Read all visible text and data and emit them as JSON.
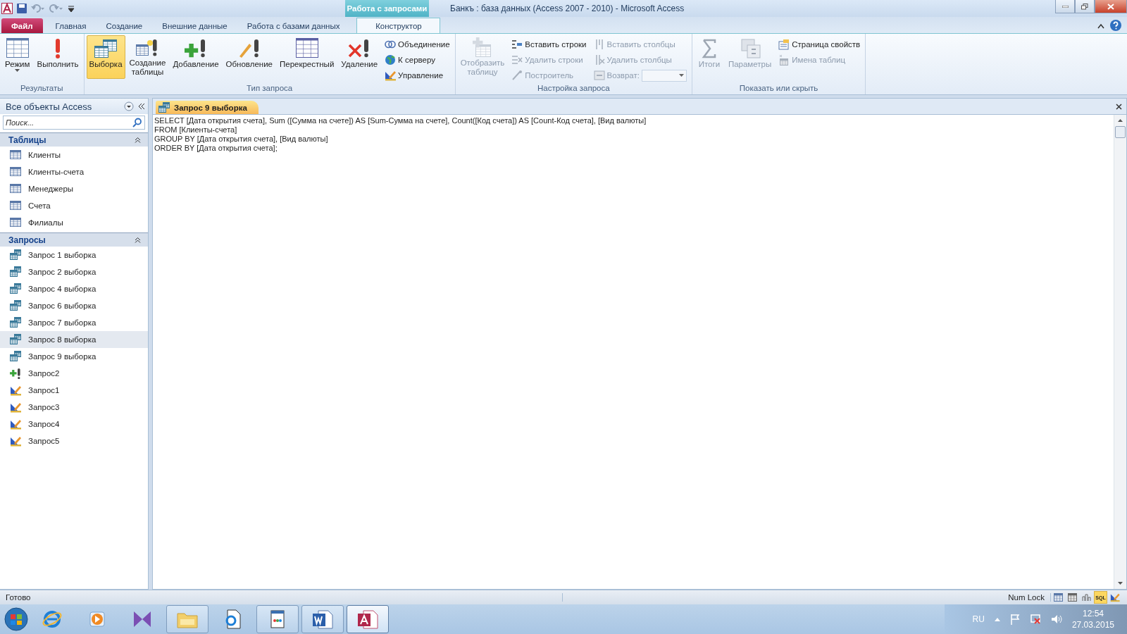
{
  "title_bar": {
    "title": "Банкъ : база данных (Access 2007 - 2010)  -  Microsoft Access",
    "context_tab": "Работа с запросами"
  },
  "ribbon_tabs": [
    {
      "label": "Файл",
      "kind": "file",
      "selected": false
    },
    {
      "label": "Главная",
      "kind": "tab",
      "selected": false
    },
    {
      "label": "Создание",
      "kind": "tab",
      "selected": false
    },
    {
      "label": "Внешние данные",
      "kind": "tab",
      "selected": false
    },
    {
      "label": "Работа с базами данных",
      "kind": "tab",
      "selected": false
    },
    {
      "label": "Конструктор",
      "kind": "context",
      "selected": true
    }
  ],
  "ribbon_groups": [
    {
      "label": "Результаты",
      "buttons": [
        {
          "kind": "large",
          "label": "Режим",
          "dropdown": true,
          "disabled": false
        },
        {
          "kind": "large",
          "label": "Выполнить",
          "disabled": false
        }
      ]
    },
    {
      "label": "Тип запроса",
      "buttons": [
        {
          "kind": "large",
          "label": "Выборка",
          "selected": true,
          "disabled": false
        },
        {
          "kind": "large",
          "label": "Создание таблицы",
          "selected": false,
          "disabled": false
        },
        {
          "kind": "large",
          "label": "Добавление",
          "selected": false,
          "disabled": false
        },
        {
          "kind": "large",
          "label": "Обновление",
          "selected": false,
          "disabled": false
        },
        {
          "kind": "large",
          "label": "Перекрестный",
          "selected": false,
          "disabled": false
        },
        {
          "kind": "large",
          "label": "Удаление",
          "selected": false,
          "disabled": false
        },
        {
          "kind": "small",
          "label": "Объединение",
          "disabled": false
        },
        {
          "kind": "small",
          "label": "К серверу",
          "disabled": false
        },
        {
          "kind": "small",
          "label": "Управление",
          "disabled": false
        }
      ]
    },
    {
      "label": "Настройка запроса",
      "buttons": [
        {
          "kind": "large",
          "label": "Отобразить таблицу",
          "disabled": true
        },
        {
          "kind": "small",
          "label": "Вставить строки",
          "disabled": false
        },
        {
          "kind": "small",
          "label": "Удалить строки",
          "disabled": true
        },
        {
          "kind": "small",
          "label": "Построитель",
          "disabled": true
        },
        {
          "kind": "small",
          "label": "Вставить столбцы",
          "disabled": true
        },
        {
          "kind": "small",
          "label": "Удалить столбцы",
          "disabled": true
        },
        {
          "kind": "combo",
          "label": "Возврат:",
          "disabled": true
        }
      ]
    },
    {
      "label": "Показать или скрыть",
      "buttons": [
        {
          "kind": "large",
          "label": "Итоги",
          "disabled": true
        },
        {
          "kind": "large",
          "label": "Параметры",
          "disabled": true
        },
        {
          "kind": "small",
          "label": "Страница свойств",
          "disabled": false
        },
        {
          "kind": "small",
          "label": "Имена таблиц",
          "disabled": true
        }
      ]
    }
  ],
  "nav_pane": {
    "title": "Все объекты Access",
    "search": {
      "placeholder": "Поиск..."
    },
    "sections": [
      {
        "label": "Таблицы",
        "expanded": true,
        "items": [
          {
            "label": "Клиенты",
            "kind": "table",
            "selected": false
          },
          {
            "label": "Клиенты-счета",
            "kind": "table",
            "selected": false
          },
          {
            "label": "Менеджеры",
            "kind": "table",
            "selected": false
          },
          {
            "label": "Счета",
            "kind": "table",
            "selected": false
          },
          {
            "label": "Филиалы",
            "kind": "table",
            "selected": false
          }
        ]
      },
      {
        "label": "Запросы",
        "expanded": true,
        "items": [
          {
            "label": "Запрос 1 выборка",
            "kind": "select",
            "selected": false
          },
          {
            "label": "Запрос 2 выборка",
            "kind": "select",
            "selected": false
          },
          {
            "label": "Запрос 4 выборка",
            "kind": "select",
            "selected": false
          },
          {
            "label": "Запрос 6 выборка",
            "kind": "select",
            "selected": false
          },
          {
            "label": "Запрос 7 выборка",
            "kind": "select",
            "selected": false
          },
          {
            "label": "Запрос 8 выборка",
            "kind": "select",
            "selected": true
          },
          {
            "label": "Запрос 9 выборка",
            "kind": "select",
            "selected": false
          },
          {
            "label": "Запрос2",
            "kind": "append",
            "selected": false
          },
          {
            "label": "Запрос1",
            "kind": "definition",
            "selected": false
          },
          {
            "label": "Запрос3",
            "kind": "definition",
            "selected": false
          },
          {
            "label": "Запрос4",
            "kind": "definition",
            "selected": false
          },
          {
            "label": "Запрос5",
            "kind": "definition",
            "selected": false
          }
        ]
      }
    ]
  },
  "document": {
    "tabs": [
      {
        "label": "Запрос 9 выборка",
        "selected": true
      }
    ],
    "sql_lines": [
      "SELECT [Дата открытия счета], Sum ([Сумма на счете]) AS [Sum-Сумма на счете], Count([Код счета]) AS [Count-Код счета], [Вид валюты]",
      "FROM [Клиенты-счета]",
      "GROUP BY [Дата открытия счета], [Вид валюты]",
      "ORDER BY [Дата открытия счета];"
    ]
  },
  "status_bar": {
    "text": "Готово",
    "indicator": "Num Lock",
    "views": [
      {
        "kind": "datasheet",
        "selected": false
      },
      {
        "kind": "pivot-table",
        "selected": false
      },
      {
        "kind": "pivot-chart",
        "selected": false
      },
      {
        "kind": "sql",
        "label": "SQL",
        "selected": true
      },
      {
        "kind": "design",
        "selected": false
      }
    ]
  },
  "taskbar": {
    "apps": [
      {
        "kind": "pinned"
      },
      {
        "kind": "pinned"
      },
      {
        "kind": "pinned"
      },
      {
        "kind": "running",
        "active": false
      },
      {
        "kind": "pinned"
      },
      {
        "kind": "running",
        "active": false
      },
      {
        "kind": "running",
        "active": false
      },
      {
        "kind": "running",
        "active": true
      }
    ],
    "language": "RU",
    "time": "12:54",
    "date": "27.03.2015"
  }
}
